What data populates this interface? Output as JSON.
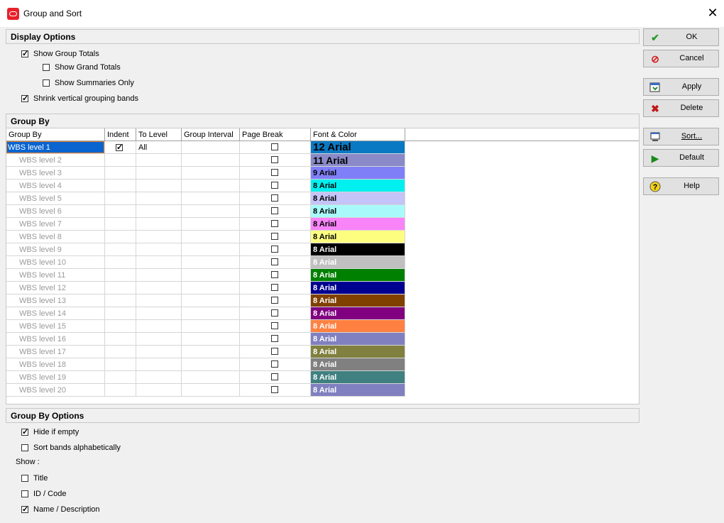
{
  "window": {
    "title": "Group and Sort"
  },
  "display_options": {
    "header": "Display Options",
    "show_group_totals": {
      "label": "Show Group Totals",
      "checked": true
    },
    "show_grand_totals": {
      "label": "Show Grand Totals",
      "checked": false
    },
    "show_summaries_only": {
      "label": "Show Summaries Only",
      "checked": false
    },
    "shrink_bands": {
      "label": "Shrink vertical grouping bands",
      "checked": true
    }
  },
  "group_by": {
    "header": "Group By",
    "columns": [
      "Group By",
      "Indent",
      "To Level",
      "Group Interval",
      "Page Break",
      "Font & Color"
    ],
    "rows": [
      {
        "name": "WBS level 1",
        "indent": true,
        "to_level": "All",
        "font": "12 Arial",
        "bg": "#0a79c4",
        "fg": "#000000"
      },
      {
        "name": "WBS level 2",
        "font": "11 Arial",
        "bg": "#8a8ac8",
        "fg": "#000000"
      },
      {
        "name": "WBS level 3",
        "font": "9 Arial",
        "bg": "#7f7ff8",
        "fg": "#000000"
      },
      {
        "name": "WBS level 4",
        "font": "8 Arial",
        "bg": "#00f0f0",
        "fg": "#000000"
      },
      {
        "name": "WBS level 5",
        "font": "8 Arial",
        "bg": "#c4c4f8",
        "fg": "#000000"
      },
      {
        "name": "WBS level 6",
        "font": "8 Arial",
        "bg": "#a8fafa",
        "fg": "#000000"
      },
      {
        "name": "WBS level 7",
        "font": "8 Arial",
        "bg": "#f884f8",
        "fg": "#000000"
      },
      {
        "name": "WBS level 8",
        "font": "8 Arial",
        "bg": "#fdfd80",
        "fg": "#000000"
      },
      {
        "name": "WBS level 9",
        "font": "8 Arial",
        "bg": "#000000",
        "fg": "#ffffff"
      },
      {
        "name": "WBS level 10",
        "font": "8 Arial",
        "bg": "#c0c0c0",
        "fg": "#ffffff"
      },
      {
        "name": "WBS level 11",
        "font": "8 Arial",
        "bg": "#008000",
        "fg": "#ffffff"
      },
      {
        "name": "WBS level 12",
        "font": "8 Arial",
        "bg": "#000090",
        "fg": "#ffffff"
      },
      {
        "name": "WBS level 13",
        "font": "8 Arial",
        "bg": "#804000",
        "fg": "#ffffff"
      },
      {
        "name": "WBS level 14",
        "font": "8 Arial",
        "bg": "#800080",
        "fg": "#ffffff"
      },
      {
        "name": "WBS level 15",
        "font": "8 Arial",
        "bg": "#ff8040",
        "fg": "#ffffff"
      },
      {
        "name": "WBS level 16",
        "font": "8 Arial",
        "bg": "#8080c0",
        "fg": "#ffffff"
      },
      {
        "name": "WBS level 17",
        "font": "8 Arial",
        "bg": "#808040",
        "fg": "#ffffff"
      },
      {
        "name": "WBS level 18",
        "font": "8 Arial",
        "bg": "#808080",
        "fg": "#ffffff"
      },
      {
        "name": "WBS level 19",
        "font": "8 Arial",
        "bg": "#408080",
        "fg": "#ffffff"
      },
      {
        "name": "WBS level 20",
        "font": "8 Arial",
        "bg": "#8080c0",
        "fg": "#ffffff"
      }
    ]
  },
  "group_by_options": {
    "header": "Group By Options",
    "hide_if_empty": {
      "label": "Hide if empty",
      "checked": true
    },
    "sort_bands": {
      "label": "Sort bands alphabetically",
      "checked": false
    },
    "show_label": "Show :",
    "title": {
      "label": "Title",
      "checked": false
    },
    "id_code": {
      "label": "ID / Code",
      "checked": false
    },
    "name_desc": {
      "label": "Name / Description",
      "checked": true
    }
  },
  "buttons": {
    "ok": "OK",
    "cancel": "Cancel",
    "apply": "Apply",
    "delete": "Delete",
    "sort": "Sort...",
    "default": "Default",
    "help": "Help"
  }
}
